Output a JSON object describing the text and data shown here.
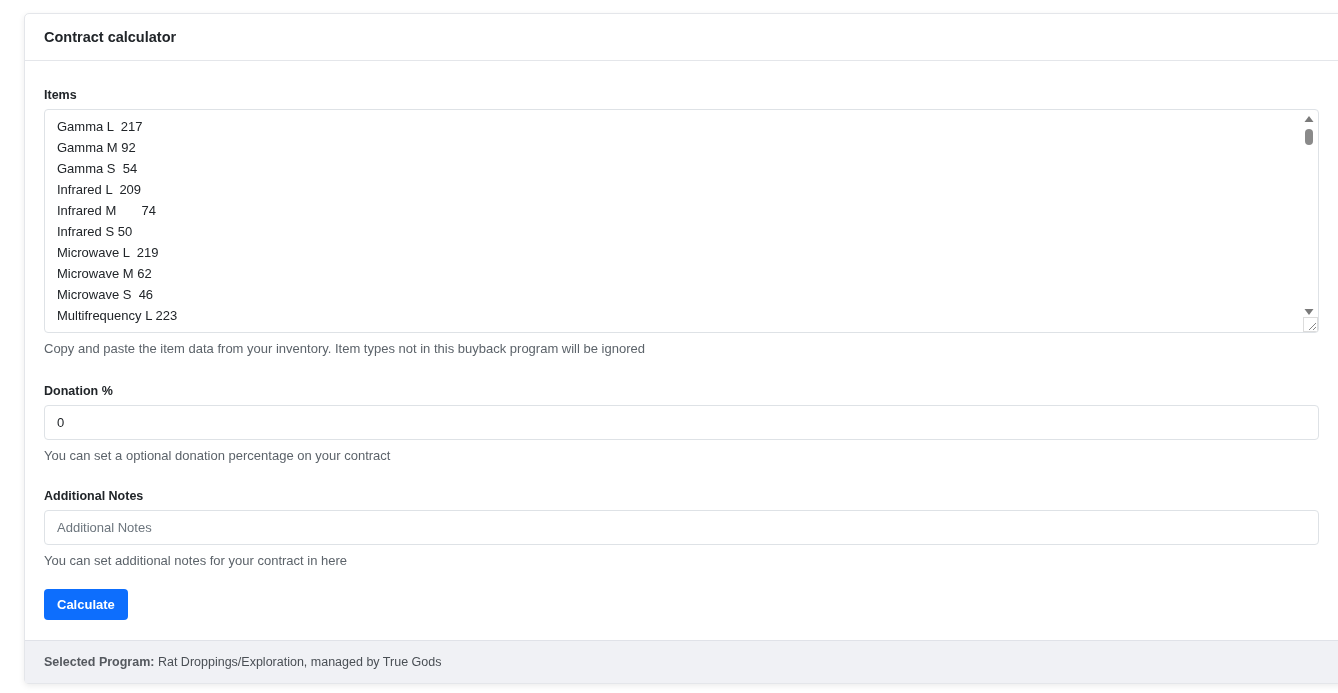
{
  "card": {
    "title": "Contract calculator"
  },
  "items": {
    "label": "Items",
    "lines": [
      "Gamma L  217",
      "Gamma M 92",
      "Gamma S  54",
      "Infrared L  209",
      "Infrared M       74",
      "Infrared S 50",
      "Microwave L  219",
      "Microwave M 62",
      "Microwave S  46",
      "Multifrequency L 223"
    ],
    "help": "Copy and paste the item data from your inventory. Item types not in this buyback program will be ignored"
  },
  "donation": {
    "label": "Donation %",
    "value": "0",
    "help": "You can set a optional donation percentage on your contract"
  },
  "notes": {
    "label": "Additional Notes",
    "placeholder": "Additional Notes",
    "help": "You can set additional notes for your contract in here"
  },
  "button": "Calculate",
  "footer": "**Selected Program:** Rat Droppings/Exploration, managed by True Gods"
}
